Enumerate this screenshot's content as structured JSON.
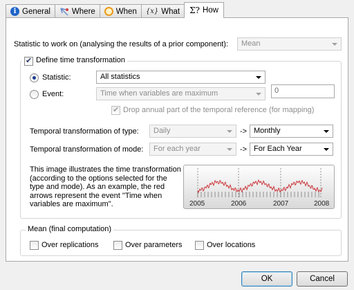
{
  "tabs": [
    {
      "label": "General",
      "icon": "info-icon"
    },
    {
      "label": "Where",
      "icon": "map-marker-icon"
    },
    {
      "label": "When",
      "icon": "clock-icon"
    },
    {
      "label": "What",
      "icon": "variable-icon",
      "glyph": "{x}"
    },
    {
      "label": "How",
      "icon": "sigma-icon",
      "glyph": "Σ?"
    }
  ],
  "statistic_row": {
    "label": "Statistic to work on (analysing the results of a prior component):",
    "value": "Mean"
  },
  "time_group": {
    "title": "Define time transformation",
    "checked": true,
    "statistic_label": "Statistic:",
    "statistic_value": "All statistics",
    "event_label": "Event:",
    "event_value": "Time when variables are maximum",
    "event_number": "0",
    "drop_annual_label": "Drop annual part of the temporal reference (for mapping)",
    "type_label": "Temporal transformation of type:",
    "type_from": "Daily",
    "type_to": "Monthly",
    "mode_label": "Temporal transformation of mode:",
    "mode_from": "For each year",
    "mode_to": "For Each Year",
    "arrow": "->",
    "description": [
      "This image illustrates the time transformation",
      "(according to the options selected for the",
      "type and mode). As an example, the red",
      "arrows represent the event \"Time when",
      "variables are maximum\"."
    ],
    "chart_years": [
      "2005",
      "2006",
      "2007",
      "2008"
    ]
  },
  "mean_group": {
    "title": "Mean (final computation)",
    "options": [
      "Over replications",
      "Over parameters",
      "Over locations"
    ]
  },
  "buttons": {
    "ok": "OK",
    "cancel": "Cancel"
  },
  "colors": {
    "accent": "#1c3d8c",
    "series": "#c8282d"
  }
}
